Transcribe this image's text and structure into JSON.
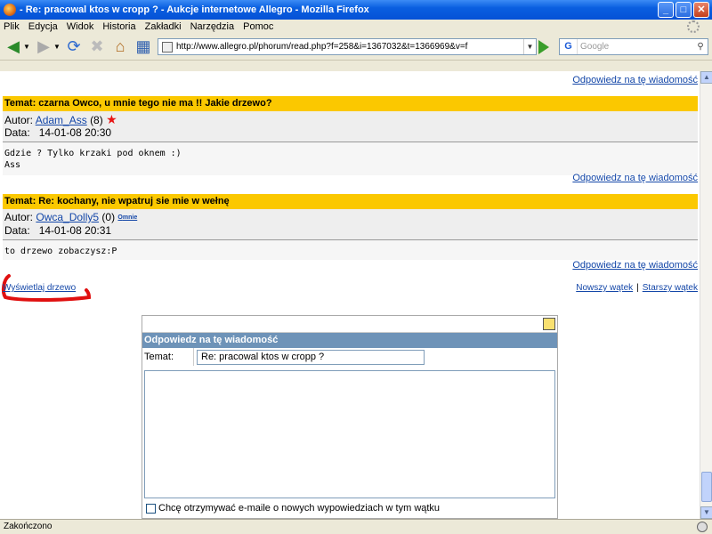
{
  "window": {
    "title": "- Re: pracowal ktos w cropp ? - Aukcje internetowe Allegro - Mozilla Firefox",
    "minimize": "_",
    "maximize": "□",
    "close": "✕"
  },
  "menu": [
    "Plik",
    "Edycja",
    "Widok",
    "Historia",
    "Zakładki",
    "Narzędzia",
    "Pomoc"
  ],
  "toolbar": {
    "url": "http://www.allegro.pl/phorum/read.php?f=258&i=1367032&t=1366969&v=f",
    "search_placeholder": "Google",
    "search_engine": "G"
  },
  "reply_link": "Odpowiedz na tę wiadomość",
  "posts": [
    {
      "topic": "Temat: czarna Owco, u mnie tego nie ma !! Jakie drzewo?",
      "author_label": "Autor:",
      "author": "Adam_Ass",
      "score": "(8)",
      "badge": "star",
      "date_label": "Data:",
      "date": "14-01-08 20:30",
      "body": "Gdzie ? Tylko krzaki pod oknem :)\nAss"
    },
    {
      "topic": "Temat: Re: kochany, nie wpatruj sie mie w wełnę",
      "author_label": "Autor:",
      "author": "Owca_Dolly5",
      "score": "(0)",
      "badge": "mnie",
      "badge_prefix": "O",
      "date_label": "Data:",
      "date": "14-01-08 20:31",
      "body": "to drzewo zobaczysz:P"
    }
  ],
  "view_tree": "Wyświetlaj drzewo",
  "pager": {
    "newer": "Nowszy wątek",
    "separator": "|",
    "older": "Starszy wątek"
  },
  "form": {
    "heading": "Odpowiedz na tę wiadomość",
    "subject_label": "Temat:",
    "subject_value": "Re: pracowal ktos w cropp ?",
    "checkbox_label": "Chcę otrzymywać e-maile o nowych wypowiedziach w tym wątku"
  },
  "status": "Zakończono",
  "colors": {
    "topic_bg": "#fbc800",
    "form_header": "#6e93b8",
    "link": "#1447a8",
    "annotation_red": "#e01010"
  }
}
